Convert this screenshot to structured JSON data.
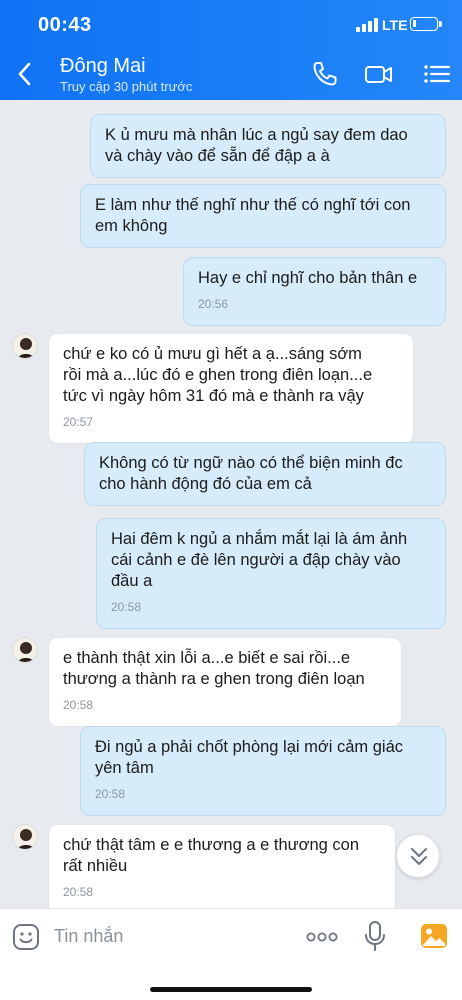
{
  "status_bar": {
    "time": "00:43",
    "network": "LTE",
    "battery_percent": 15
  },
  "header": {
    "contact_name": "Đông Mai",
    "contact_status": "Truy cập 30 phút trước"
  },
  "icons": {
    "back": "chevron-left-icon",
    "call": "phone-icon",
    "video": "video-camera-icon",
    "menu": "list-menu-icon",
    "emoji": "emoji-icon",
    "more": "more-dots-icon",
    "mic": "microphone-icon",
    "gallery": "image-gallery-icon",
    "scroll_down": "double-chevron-down-icon"
  },
  "messages": [
    {
      "sender": "me",
      "text": "K ủ mưu mà nhân lúc a ngủ say đem dao\nvà chày vào để sẵn để đập a à",
      "time": ""
    },
    {
      "sender": "me",
      "text": "E làm như thế nghĩ như thế có nghĩ tới con\nem không",
      "time": ""
    },
    {
      "sender": "me",
      "text": "Hay e chỉ nghĩ cho bản thân e",
      "time": "20:56"
    },
    {
      "sender": "them",
      "text": "chứ e ko có ủ mưu gì hết a ạ...sáng sớm\nrồi mà a...lúc đó e ghen trong điên loạn...e\ntức vì ngày hôm 31 đó mà e thành ra vậy",
      "time": "20:57"
    },
    {
      "sender": "me",
      "text": "Không có từ ngữ nào có thể biện minh đc\ncho hành động đó của em cả",
      "time": ""
    },
    {
      "sender": "me",
      "text": "Hai đêm k ngủ a nhắm mắt lại là ám ảnh\ncái cảnh e đè lên người a đập chày vào\nđầu a",
      "time": "20:58"
    },
    {
      "sender": "them",
      "text": "e thành thật xin lỗi a...e biết e sai rồi...e\nthương a thành ra e ghen trong điên loạn",
      "time": "20:58"
    },
    {
      "sender": "me",
      "text": "Đi ngủ a phải chốt phòng lại mới cảm giác\nyên tâm",
      "time": "20:58"
    },
    {
      "sender": "them",
      "text": "chứ thật tâm e e thương a e thương con\nrất nhiều",
      "time": "20:58"
    }
  ],
  "composer": {
    "placeholder": "Tin nhắn"
  },
  "colors": {
    "header": "#1a7ff7",
    "my_bubble": "#d7ecfb",
    "their_bubble": "#ffffff",
    "chat_bg": "#e7eaef"
  }
}
